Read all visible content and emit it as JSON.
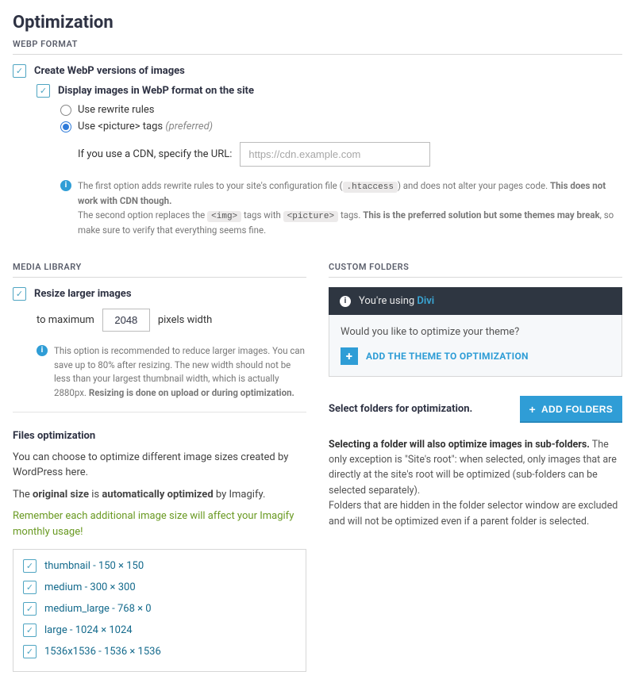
{
  "page_title": "Optimization",
  "webp": {
    "section_label": "WEBP FORMAT",
    "create_label": "Create WebP versions of images",
    "display_label": "Display images in WebP format on the site",
    "radio_rewrite": "Use rewrite rules",
    "radio_picture_prefix": "Use <picture> tags ",
    "radio_picture_suffix": "(preferred)",
    "cdn_label": "If you use a CDN, specify the URL:",
    "cdn_placeholder": "https://cdn.example.com",
    "info_a": "The first option adds rewrite rules to your site's configuration file (",
    "info_a_code": ".htaccess",
    "info_a2": ") and does not alter your pages code. ",
    "info_a_bold": "This does not work with CDN though.",
    "info_b1": "The second option replaces the ",
    "info_b_code1": "<img>",
    "info_b2": " tags with ",
    "info_b_code2": "<picture>",
    "info_b3": " tags. ",
    "info_b_bold": "This is the preferred solution but some themes may break",
    "info_b4": ", so make sure to verify that everything seems fine."
  },
  "media": {
    "section_label": "MEDIA LIBRARY",
    "resize_label": "Resize larger images",
    "to_max": "to maximum",
    "max_value": "2048",
    "px_width": "pixels width",
    "info_1": "This option is recommended to reduce larger images. You can save up to 80% after resizing. The new width should not be less than your largest thumbnail width, which is actually 2880px. ",
    "info_bold": "Resizing is done on upload or during optimization.",
    "files_heading": "Files optimization",
    "files_desc": "You can choose to optimize different image sizes created by WordPress here.",
    "orig_1": "The ",
    "orig_b1": "original size",
    "orig_2": " is ",
    "orig_b2": "automatically optimized",
    "orig_3": " by Imagify.",
    "files_warn": "Remember each additional image size will affect your Imagify monthly usage!",
    "sizes": [
      "thumbnail - 150 × 150",
      "medium - 300 × 300",
      "medium_large - 768 × 0",
      "large - 1024 × 1024",
      "1536x1536 - 1536 × 1536"
    ]
  },
  "custom": {
    "section_label": "CUSTOM FOLDERS",
    "using_prefix": "You're using ",
    "theme_name": "Divi",
    "question": "Would you like to optimize your theme?",
    "add_theme_btn": "ADD THE THEME TO OPTIMIZATION",
    "select_label": "Select folders for optimization.",
    "add_folders_btn": "ADD FOLDERS",
    "body_b": "Selecting a folder will also optimize images in sub-folders.",
    "body_1": " The only exception is \"Site's root\": when selected, only images that are directly at the site's root will be optimized (sub-folders can be selected separately).",
    "body_2": "Folders that are hidden in the folder selector window are excluded and will not be optimized even if a parent folder is selected."
  }
}
